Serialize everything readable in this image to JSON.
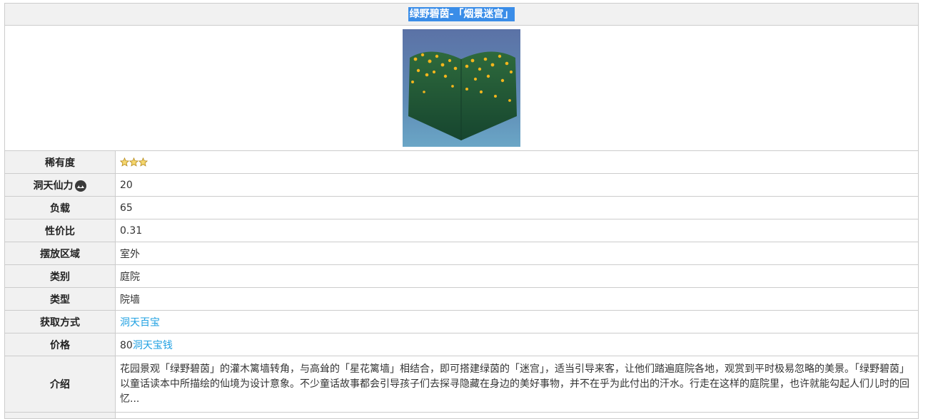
{
  "title": "绿野碧茵-「烟景迷宫」",
  "image": {
    "icon": "hedge-maze-wall-corner-image",
    "colors": {
      "background": "#5f7fb0",
      "hedge": "#1f5a3c",
      "flowers": "#f2b51c"
    }
  },
  "rows": [
    {
      "label": "稀有度",
      "value": "",
      "stars": 3
    },
    {
      "label": "洞天仙力",
      "value": "20"
    },
    {
      "label": "负载",
      "value": "65"
    },
    {
      "label": "性价比",
      "value": "0.31"
    },
    {
      "label": "摆放区域",
      "value": "室外"
    },
    {
      "label": "类别",
      "value": "庭院"
    },
    {
      "label": "类型",
      "value": "院墙"
    },
    {
      "label": "获取方式",
      "link": "洞天百宝"
    },
    {
      "label": "价格",
      "value": "80",
      "link": "洞天宝钱"
    },
    {
      "label": "介绍",
      "value": "花园景观「绿野碧茵」的灌木篱墙转角，与高耸的「星花篱墙」相结合，即可搭建绿茵的「迷宫」，适当引导来客，让他们踏遍庭院各地，观赏到平时极易忽略的美景。「绿野碧茵」以童话读本中所描绘的仙境为设计意象。不少童话故事都会引导孩子们去探寻隐藏在身边的美好事物，并不在乎为此付出的汗水。行走在这样的庭院里，也许就能勾起人们儿时的回忆..."
    }
  ],
  "colors": {
    "accent": "#1fa0e2",
    "header_bg": "#f1f1f1",
    "border": "#cccccc",
    "title_highlight": "#3a8de8"
  }
}
